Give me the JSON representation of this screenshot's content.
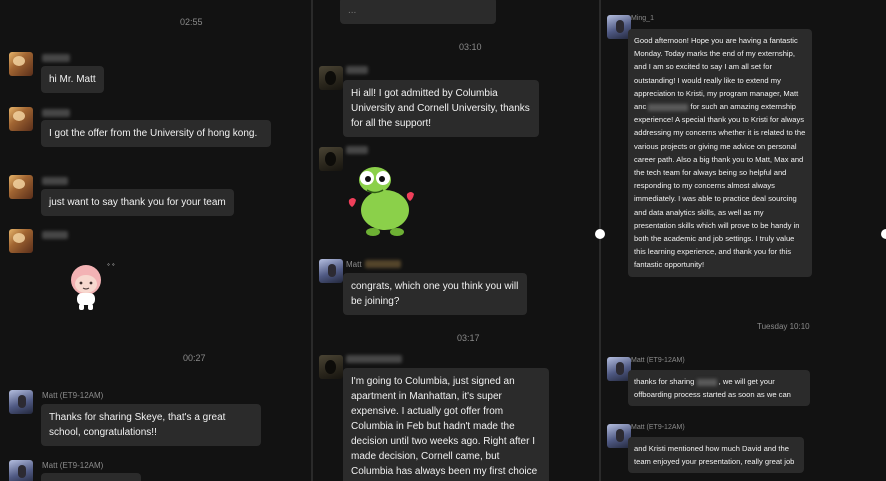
{
  "left_panel": {
    "timestamp_top": "02:55",
    "timestamp_mid": "00:27",
    "messages": [
      {
        "text": "hi Mr. Matt"
      },
      {
        "text": "I got the offer from the University of hong kong."
      },
      {
        "text": "just want to say thank you for your team"
      }
    ],
    "matt_message": {
      "sender": "Matt (ET9-12AM)",
      "text": "Thanks for sharing Skeye, that's a great school, congratulations!!"
    },
    "matt_sender_bottom": "Matt (ET9-12AM)"
  },
  "middle_panel": {
    "timestamp_top": "03:10",
    "timestamp_mid": "03:17",
    "partial_top_text": "...",
    "messages": [
      {
        "text": "Hi all! I got admitted by Columbia University and Cornell University, thanks for all the support!"
      },
      {
        "sender": "Matt",
        "text": "congrats, which one you think you will be joining?"
      },
      {
        "text": "I'm going to Columbia, just signed an apartment in Manhattan, it's super expensive. I actually got offer from Columbia in Feb but hadn't made the decision until two weeks ago. Right after I made decision, Cornell came, but Columbia has always been my first choice anyway."
      }
    ]
  },
  "right_panel": {
    "sender_top": "Ming_1",
    "long_message_part1": "Good afternoon! Hope you are having a fantastic Monday. Today marks the end of my externship, and I am so excited to say I am all set for outstanding! I would really like to extend my appreciation to Kristi, my program manager, Matt anc",
    "long_message_part2": "for such an amazing externship experience! A special thank you to Kristi for always addressing my concerns whether it is related to the various projects or giving me advice on personal career path. Also a big thank you to Matt, Max and the tech team for always being so helpful and responding to my concerns almost always immediately. I was able to practice deal sourcing and data analytics skills, as well as my presentation skills which will prove to be handy in both the academic and job settings. I truly value this learning experience, and thank you for this fantastic opportunity!",
    "timestamp": "Tuesday 10:10",
    "replies": [
      {
        "sender": "Matt (ET9-12AM)",
        "text_part1": "thanks for sharing",
        "text_part2": ", we will get your offboarding process started as soon as we can"
      },
      {
        "sender": "Matt (ET9-12AM)",
        "text": "and Kristi mentioned how much David and the team enjoyed your presentation, really great job"
      }
    ]
  }
}
